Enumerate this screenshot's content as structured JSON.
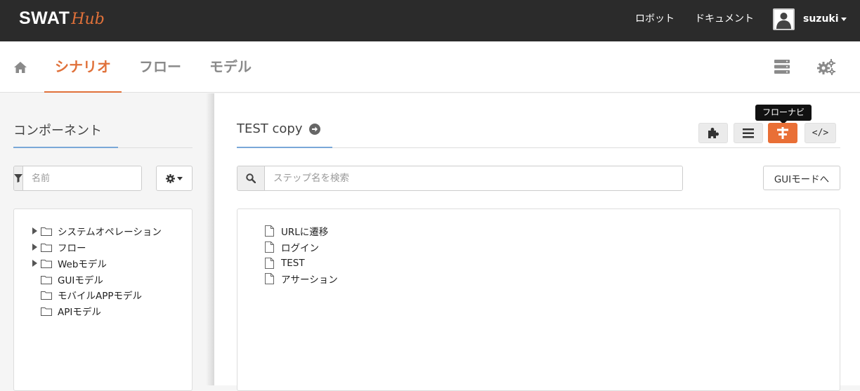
{
  "header": {
    "logo_main": "SWAT",
    "logo_sub": "Hub",
    "nav": {
      "robot": "ロボット",
      "docs": "ドキュメント"
    },
    "user": {
      "name": "suzuki"
    }
  },
  "subnav": {
    "tabs": [
      {
        "label": "シナリオ",
        "active": true
      },
      {
        "label": "フロー",
        "active": false
      },
      {
        "label": "モデル",
        "active": false
      }
    ]
  },
  "left_panel": {
    "title": "コンポーネント",
    "filter": {
      "placeholder": "名前",
      "value": ""
    },
    "tree": [
      {
        "label": "システムオペレーション",
        "expandable": true
      },
      {
        "label": "フロー",
        "expandable": true
      },
      {
        "label": "Webモデル",
        "expandable": true
      },
      {
        "label": "GUIモデル",
        "expandable": false
      },
      {
        "label": "モバイルAPPモデル",
        "expandable": false
      },
      {
        "label": "APIモデル",
        "expandable": false
      }
    ]
  },
  "main": {
    "scenario_title": "TEST copy",
    "toolbar": {
      "code_label": "</>",
      "active_button": "flownav"
    },
    "tooltip": "フローナビ",
    "search": {
      "placeholder": "ステップ名を検索",
      "value": ""
    },
    "gui_mode_button": "GUIモードへ",
    "steps": [
      {
        "label": "URLに遷移"
      },
      {
        "label": "ログイン"
      },
      {
        "label": "TEST"
      },
      {
        "label": "アサーション"
      }
    ]
  },
  "colors": {
    "accent": "#e0713a",
    "topbar": "#2b2b2b",
    "active_button": "#e96f36",
    "underline": "#7aa8d8"
  },
  "icons": [
    "home-icon",
    "server-icon",
    "gears-icon",
    "filter-icon",
    "gear-icon",
    "search-icon",
    "puzzle-icon",
    "list-icon",
    "flownav-icon",
    "code-icon",
    "folder-icon",
    "file-icon",
    "arrow-right-circle-icon"
  ]
}
